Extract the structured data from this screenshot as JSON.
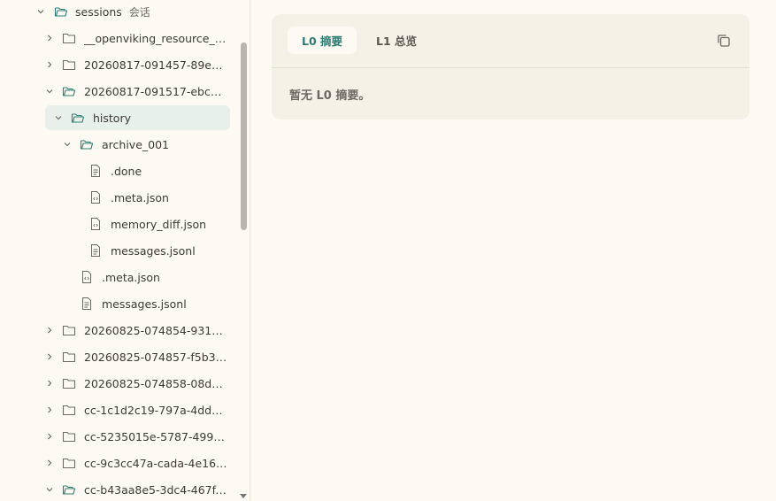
{
  "tree": {
    "root": {
      "label": "sessions",
      "sublabel": "会话"
    },
    "items": [
      {
        "label": "__openviking_resource_re...",
        "type": "folder",
        "expanded": false
      },
      {
        "label": "20260817-091457-89e31...",
        "type": "folder",
        "expanded": false
      },
      {
        "label": "20260817-091517-ebc57...",
        "type": "folder",
        "expanded": true
      },
      {
        "label": "history",
        "type": "folder",
        "expanded": true,
        "selected": true
      },
      {
        "label": "archive_001",
        "type": "folder",
        "expanded": true
      },
      {
        "label": ".done",
        "type": "file-text"
      },
      {
        "label": ".meta.json",
        "type": "file-json"
      },
      {
        "label": "memory_diff.json",
        "type": "file-json"
      },
      {
        "label": "messages.jsonl",
        "type": "file-text"
      },
      {
        "label": ".meta.json",
        "type": "file-json"
      },
      {
        "label": "messages.jsonl",
        "type": "file-text"
      },
      {
        "label": "20260825-074854-931d0...",
        "type": "folder",
        "expanded": false
      },
      {
        "label": "20260825-074857-f5b35...",
        "type": "folder",
        "expanded": false
      },
      {
        "label": "20260825-074858-08dd2...",
        "type": "folder",
        "expanded": false
      },
      {
        "label": "cc-1c1d2c19-797a-4ddb-...",
        "type": "folder",
        "expanded": false
      },
      {
        "label": "cc-5235015e-5787-4997-...",
        "type": "folder",
        "expanded": false
      },
      {
        "label": "cc-9c3cc47a-cada-4e16-...",
        "type": "folder",
        "expanded": false
      },
      {
        "label": "cc-b43aa8e5-3dc4-467f-...",
        "type": "folder",
        "expanded": true
      }
    ]
  },
  "panel": {
    "tabs": [
      {
        "label": "L0 摘要",
        "active": true
      },
      {
        "label": "L1 总览",
        "active": false
      }
    ],
    "copy_icon": "copy-icon",
    "body_text": "暂无 L0 摘要。"
  },
  "colors": {
    "background": "#fdfaf4",
    "panel": "#f5f1e6",
    "accent": "#2f7d73",
    "selected_row": "#e8f0ec"
  }
}
